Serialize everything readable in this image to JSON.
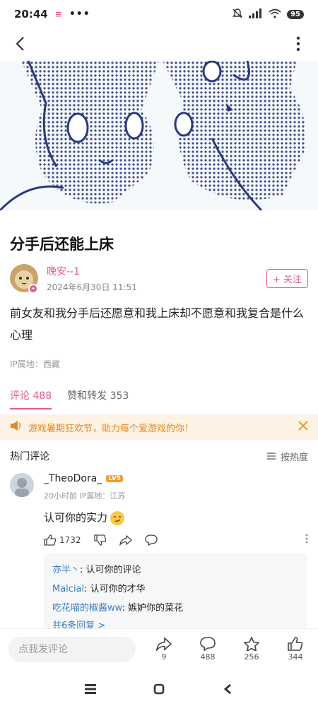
{
  "status_bar": {
    "time": "20:44",
    "battery": "95"
  },
  "post": {
    "title": "分手后还能上床",
    "author": "晚安--1",
    "date": "2024年6月30日 11:51",
    "follow_label": "+ 关注",
    "body": "前女友和我分手后还愿意和我上床却不愿意和我复合是什么心理",
    "ip_location": "IP属地：西藏"
  },
  "tabs": [
    {
      "label": "评论 488"
    },
    {
      "label": "赞和转发 353"
    }
  ],
  "banner": {
    "text": "游戏暑期狂欢节，助力每个爱游戏的你！"
  },
  "comments_section": {
    "title": "热门评论",
    "sort_label": "按热度"
  },
  "comment": {
    "name": "_TheoDora_",
    "level": "LV5",
    "meta": "20小时前  IP属地：江苏",
    "text": "认可你的实力",
    "likes": "1732",
    "replies": [
      {
        "name": "亦半丶",
        "text": ": 认可你的评论"
      },
      {
        "name": "Malcial",
        "text": ": 认可你的才华"
      },
      {
        "name": "吃花喵的椒酱ww",
        "text": ": 嫉妒你的菜花"
      }
    ],
    "more_replies": "共6条回复 >"
  },
  "bottom_bar": {
    "placeholder": "点我发评论",
    "share_count": "9",
    "comment_count": "488",
    "favorite_count": "256",
    "like_count": "344"
  }
}
